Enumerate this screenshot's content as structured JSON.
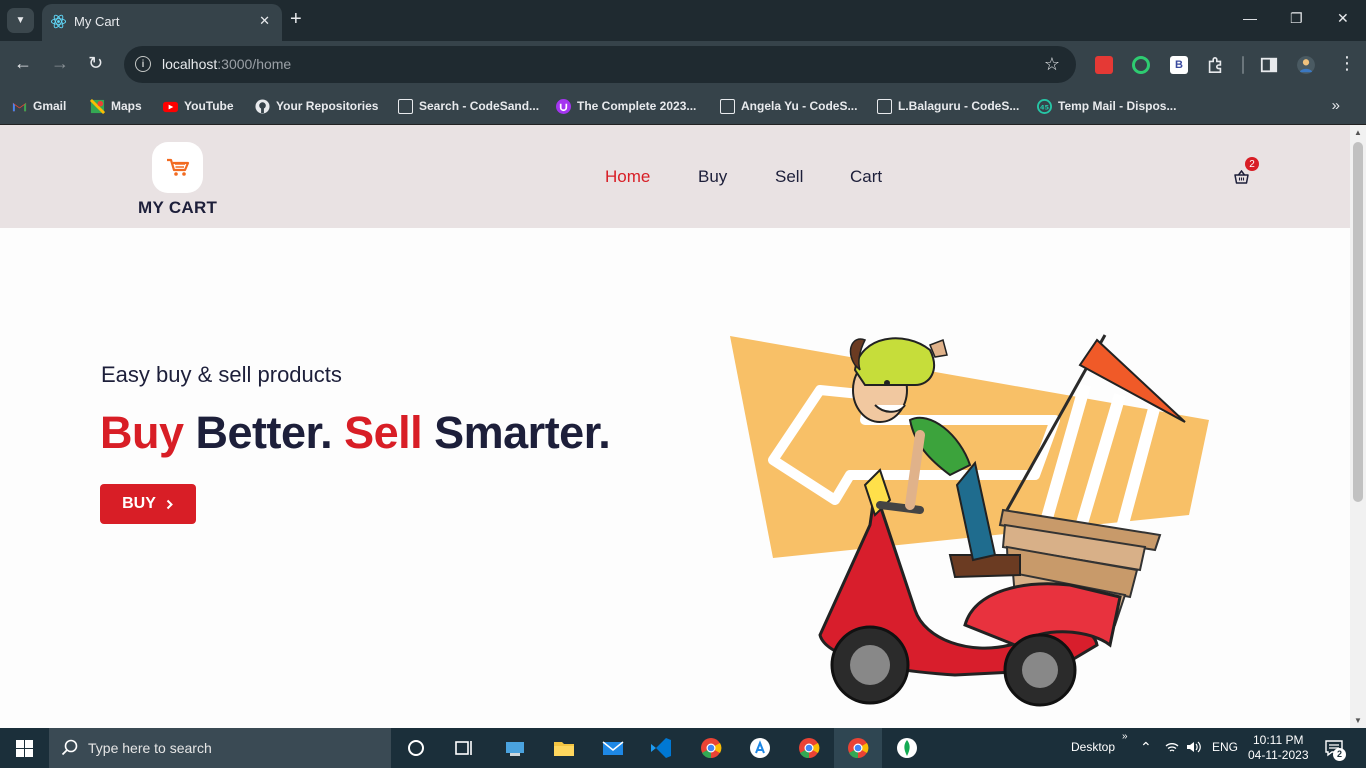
{
  "browser": {
    "tab_title": "My Cart",
    "url_host": "localhost",
    "url_path": ":3000/home",
    "bookmarks": [
      "Gmail",
      "Maps",
      "YouTube",
      "Your Repositories",
      "Search - CodeSand...",
      "The Complete 2023...",
      "Angela Yu - CodeS...",
      "L.Balaguru - CodeS...",
      "Temp Mail - Dispos..."
    ]
  },
  "site": {
    "logo_text": "MY CART",
    "nav": [
      "Home",
      "Buy",
      "Sell",
      "Cart"
    ],
    "active_nav": "Home",
    "cart_count": "2"
  },
  "hero": {
    "subtitle": "Easy buy & sell products",
    "title_part1": "Buy",
    "title_part2": " Better. ",
    "title_part3": "Sell",
    "title_part4": " Smarter.",
    "button_label": "BUY"
  },
  "taskbar": {
    "search_placeholder": "Type here to search",
    "desktop_label": "Desktop",
    "language": "ENG",
    "time": "10:11 PM",
    "date": "04-11-2023",
    "notification_count": "2"
  },
  "colors": {
    "accent_red": "#d81e26",
    "navy": "#1d1f3a",
    "navbar_bg": "#e9e2e3",
    "banner_orange": "#f8c067"
  }
}
